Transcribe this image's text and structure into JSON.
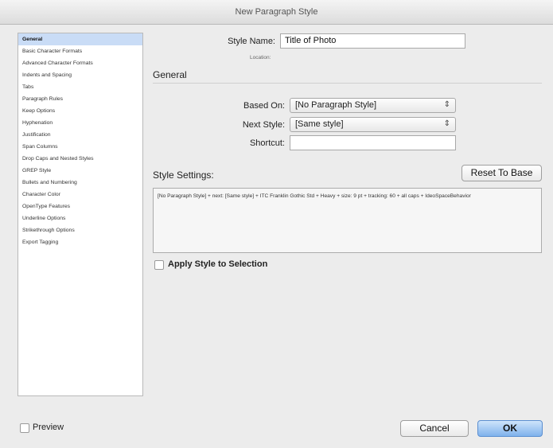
{
  "window": {
    "title": "New Paragraph Style"
  },
  "sidebar": {
    "items": [
      {
        "label": "General",
        "selected": true
      },
      {
        "label": "Basic Character Formats"
      },
      {
        "label": "Advanced Character Formats"
      },
      {
        "label": "Indents and Spacing"
      },
      {
        "label": "Tabs"
      },
      {
        "label": "Paragraph Rules"
      },
      {
        "label": "Keep Options"
      },
      {
        "label": "Hyphenation"
      },
      {
        "label": "Justification"
      },
      {
        "label": "Span Columns"
      },
      {
        "label": "Drop Caps and Nested Styles"
      },
      {
        "label": "GREP Style"
      },
      {
        "label": "Bullets and Numbering"
      },
      {
        "label": "Character Color"
      },
      {
        "label": "OpenType Features"
      },
      {
        "label": "Underline Options"
      },
      {
        "label": "Strikethrough Options"
      },
      {
        "label": "Export Tagging"
      }
    ]
  },
  "form": {
    "style_name_label": "Style Name:",
    "style_name_value": "Title of Photo",
    "location_label": "Location:",
    "general_heading": "General",
    "based_on_label": "Based On:",
    "based_on_value": "[No Paragraph Style]",
    "next_style_label": "Next Style:",
    "next_style_value": "[Same style]",
    "shortcut_label": "Shortcut:",
    "shortcut_value": "",
    "style_settings_label": "Style Settings:",
    "reset_button": "Reset To Base",
    "style_settings_text": "[No Paragraph Style] + next: [Same style] + ITC Franklin Gothic Std + Heavy + size: 9 pt + tracking: 60 + all caps + IdeoSpaceBehavior",
    "apply_style_label": "Apply Style to Selection",
    "apply_style_checked": false
  },
  "footer": {
    "preview_label": "Preview",
    "preview_checked": false,
    "cancel_button": "Cancel",
    "ok_button": "OK"
  }
}
